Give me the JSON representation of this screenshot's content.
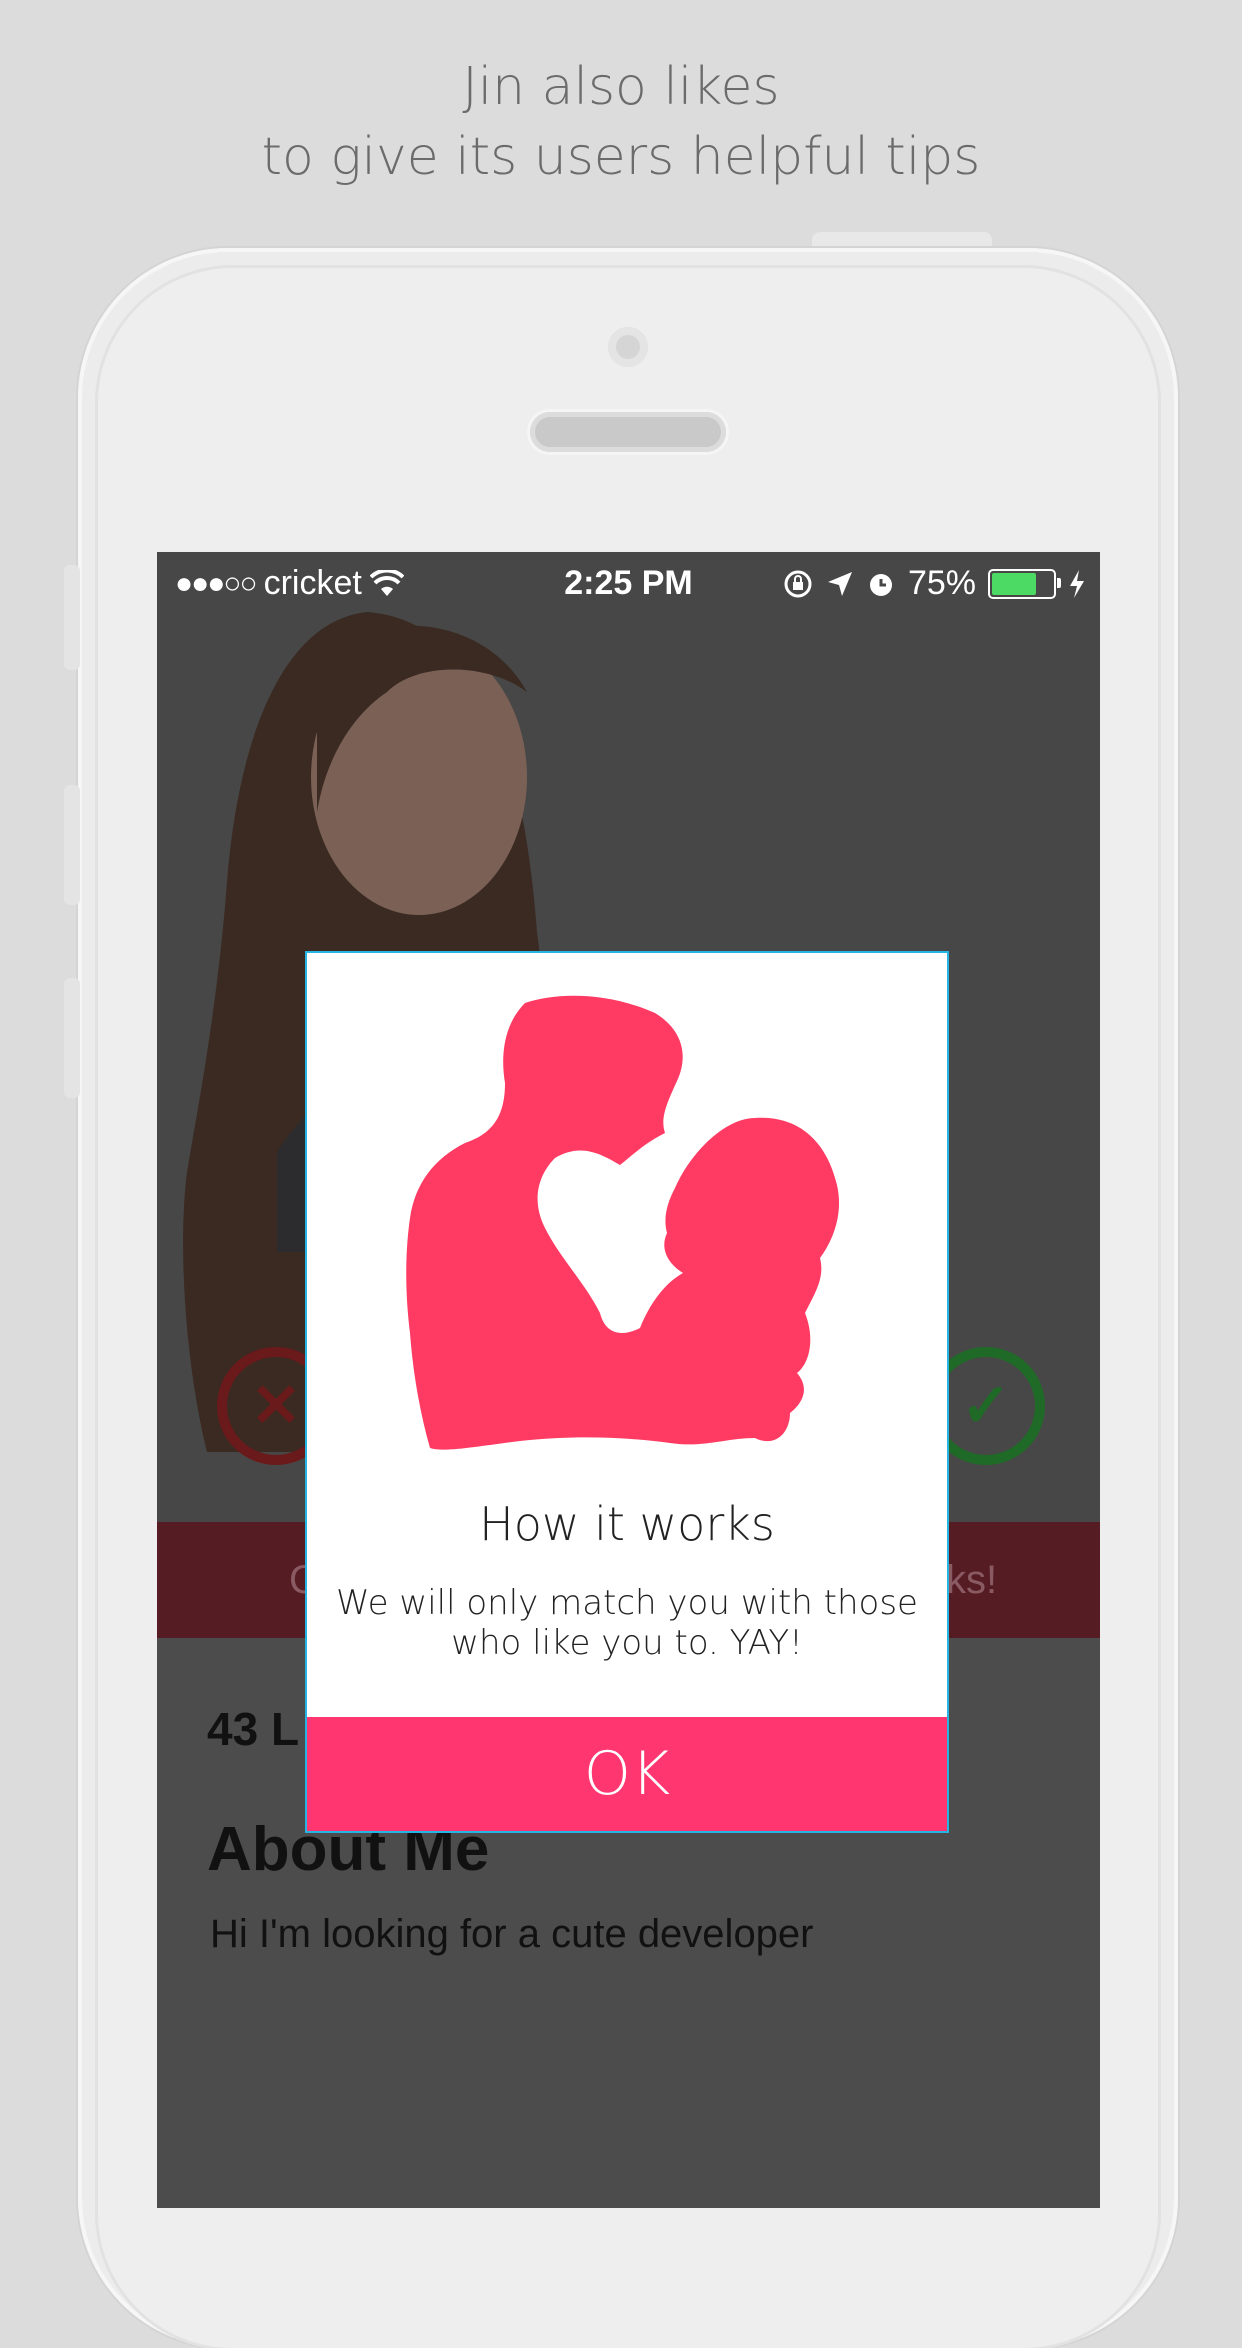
{
  "caption": {
    "line1": "Jin also likes",
    "line2": "to give its users helpful tips"
  },
  "status_bar": {
    "signal": "●●●○○",
    "carrier": "cricket",
    "time": "2:25 PM",
    "battery_percent": "75%",
    "battery_level": 0.75,
    "icons": [
      "wifi-icon",
      "rotation-lock-icon",
      "location-arrow-icon",
      "alarm-icon",
      "battery-icon",
      "charging-bolt-icon"
    ]
  },
  "profile": {
    "likes_bar_left": "C",
    "likes_bar_right": "ks!",
    "likes_count": "43 L",
    "about_title": "About Me",
    "about_text": "Hi I'm looking for a cute developer"
  },
  "modal": {
    "title": "How it works",
    "text": "We will only match you with those who like you to. YAY!",
    "ok_label": "OK"
  },
  "colors": {
    "accent": "#ff3670",
    "modal_border": "#26b5e2",
    "dislike": "#8b1c1c",
    "like": "#1f7a2a",
    "silhouette": "#ff3b63"
  }
}
